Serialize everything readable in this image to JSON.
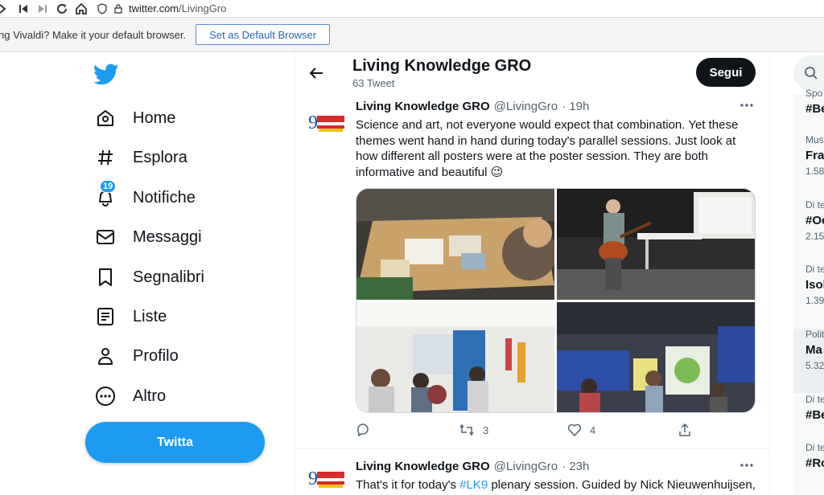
{
  "browser": {
    "url_host": "twitter.com",
    "url_path": "/LivingGro"
  },
  "notification": {
    "message": "ng Vivaldi? Make it your default browser.",
    "button": "Set as Default Browser"
  },
  "sidebar": {
    "items": [
      {
        "label": "Home",
        "icon": "home-icon"
      },
      {
        "label": "Esplora",
        "icon": "hashtag-icon"
      },
      {
        "label": "Notifiche",
        "icon": "bell-icon",
        "badge": "19"
      },
      {
        "label": "Messaggi",
        "icon": "envelope-icon"
      },
      {
        "label": "Segnalibri",
        "icon": "bookmark-icon"
      },
      {
        "label": "Liste",
        "icon": "list-icon"
      },
      {
        "label": "Profilo",
        "icon": "person-icon"
      },
      {
        "label": "Altro",
        "icon": "more-circle-icon"
      }
    ],
    "tweet_button": "Twitta"
  },
  "profile_header": {
    "name": "Living Knowledge GRO",
    "tweet_count": "63 Tweet",
    "follow_button": "Segui"
  },
  "tweets": [
    {
      "name": "Living Knowledge GRO",
      "handle": "@LivingGro",
      "time": "· 19h",
      "text": "Science and art, not everyone would expect that combination. Yet these themes went hand in hand during today's parallel sessions. Just look at how different all posters were at the poster session. They are both informative and beautiful 😉",
      "actions": {
        "reply": "",
        "retweet": "3",
        "like": "4",
        "share": ""
      }
    },
    {
      "name": "Living Knowledge GRO",
      "handle": "@LivingGro",
      "time": "· 23h",
      "text_before": "That's it for today's ",
      "hashtag": "#LK9",
      "text_after": " plenary session. Guided by Nick Nieuwenhuijsen,"
    }
  ],
  "trends": [
    {
      "category": "Spo",
      "title": "#Be",
      "count": ""
    },
    {
      "category": "Mus",
      "title": "Fra",
      "count": "1.58"
    },
    {
      "category": "Di te",
      "title": "#Oo",
      "count": "2.15"
    },
    {
      "category": "Di te",
      "title": "Isol",
      "count": "1.39"
    },
    {
      "category": "Polit",
      "title": "Ma",
      "count": "5.32"
    },
    {
      "category": "Di te",
      "title": "#Be",
      "count": ""
    },
    {
      "category": "Di te",
      "title": "#Ro",
      "count": ""
    }
  ],
  "colors": {
    "accent": "#1d9bf0",
    "text": "#0f1419",
    "muted": "#536471"
  }
}
